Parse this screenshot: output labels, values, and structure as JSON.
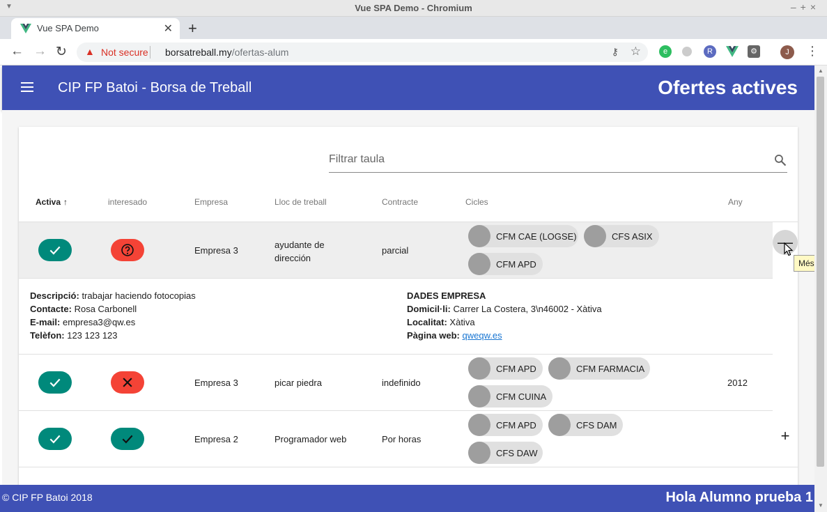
{
  "window": {
    "title": "Vue SPA Demo - Chromium"
  },
  "tab": {
    "title": "Vue SPA Demo"
  },
  "address": {
    "security": "Not secure",
    "host": "borsatreball.my",
    "path": "/ofertas-alum"
  },
  "appbar": {
    "title": "CIP FP Batoi - Borsa de Treball",
    "heading": "Ofertes actives"
  },
  "search": {
    "placeholder": "Filtrar taula"
  },
  "table": {
    "headers": {
      "activa": "Activa",
      "interesado": "interesado",
      "empresa": "Empresa",
      "lloc": "Lloc de treball",
      "contracte": "Contracte",
      "cicles": "Cicles",
      "any": "Any"
    },
    "rows": [
      {
        "activa": "yes",
        "interesado": "unknown",
        "empresa": "Empresa 3",
        "lloc": "ayudante de dirección",
        "contracte": "parcial",
        "cicles": [
          "CFM CAE (LOGSE)",
          "CFS ASIX",
          "CFM APD"
        ],
        "any": "",
        "expanded": true
      },
      {
        "activa": "yes",
        "interesado": "no",
        "empresa": "Empresa 3",
        "lloc": "picar piedra",
        "contracte": "indefinido",
        "cicles": [
          "CFM APD",
          "CFM FARMACIA",
          "CFM CUINA"
        ],
        "any": "2012",
        "expanded": false
      },
      {
        "activa": "yes",
        "interesado": "yes",
        "empresa": "Empresa 2",
        "lloc": "Programador web",
        "contracte": "Por horas",
        "cicles": [
          "CFM APD",
          "CFS DAM",
          "CFS DAW"
        ],
        "any": "",
        "expanded": false
      }
    ]
  },
  "details": {
    "descripcio_label": "Descripció:",
    "descripcio": "trabajar haciendo fotocopias",
    "contacte_label": "Contacte:",
    "contacte": "Rosa Carbonell",
    "email_label": "E-mail:",
    "email": "empresa3@qw.es",
    "telefon_label": "Telèfon:",
    "telefon": "123 123 123",
    "empresa_heading": "DADES EMPRESA",
    "domicili_label": "Domicil·li:",
    "domicili": "Carrer La Costera, 3\\n46002 - Xàtiva",
    "localitat_label": "Localitat:",
    "localitat": "Xàtiva",
    "web_label": "Pàgina web:",
    "web": "qweqw.es"
  },
  "tooltip": "Més da",
  "footer": {
    "copyright": "© CIP FP Batoi 2018",
    "greeting": "Hola Alumno prueba 1"
  },
  "colors": {
    "primary": "#3f51b5",
    "teal": "#00897b",
    "red": "#f44336"
  }
}
